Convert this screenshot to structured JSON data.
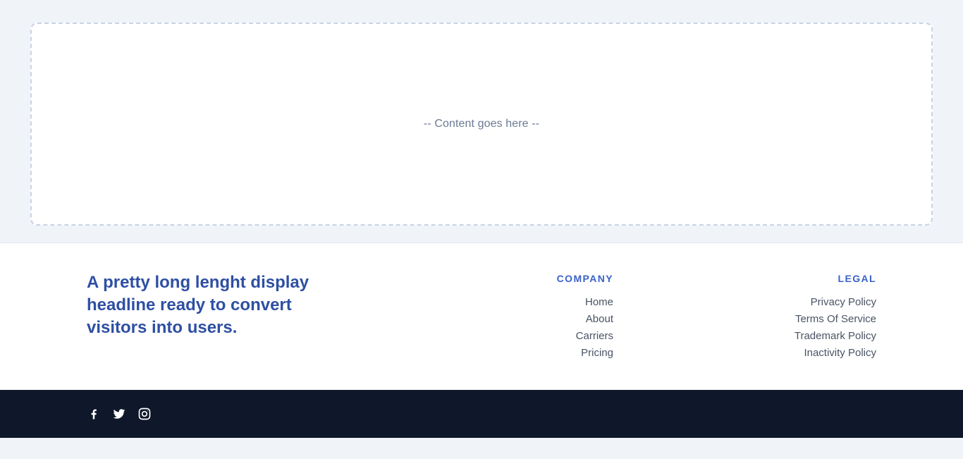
{
  "content": {
    "placeholder": "-- Content goes here --"
  },
  "footer": {
    "headline": "A pretty long lenght display headline ready to convert visitors into users.",
    "company": {
      "heading": "COMPANY",
      "links": [
        "Home",
        "About",
        "Carriers",
        "Pricing"
      ]
    },
    "legal": {
      "heading": "LEGAL",
      "links": [
        "Privacy Policy",
        "Terms Of Service",
        "Trademark Policy",
        "Inactivity Policy"
      ]
    },
    "social": {
      "icons": [
        "facebook-icon",
        "twitter-icon",
        "instagram-icon"
      ]
    }
  },
  "colors": {
    "page_bg": "#f0f3f8",
    "headline": "#2e4fa3",
    "column_heading": "#3a63c9",
    "link": "#4a5364",
    "bottom_bar": "#0f172a",
    "placeholder_text": "#6b7a93",
    "dashed_border": "#c9d3e4"
  }
}
